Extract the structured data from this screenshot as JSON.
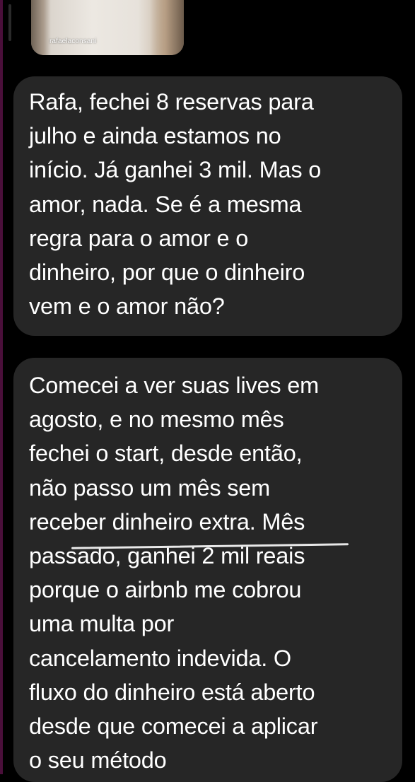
{
  "story_reply": {
    "username": "rafaelaconsani"
  },
  "messages": [
    {
      "lines": [
        "Rafa, fechei 8 reservas para",
        "julho e ainda estamos no",
        "início. Já ganhei 3 mil. Mas o",
        "amor, nada. Se é a mesma",
        "regra para o amor e o",
        "dinheiro, por que o dinheiro",
        "vem e o amor não?"
      ]
    },
    {
      "lines": [
        "Comecei a ver suas lives em",
        "agosto, e no mesmo mês",
        "fechei o start, desde então,",
        "não passo um mês sem",
        "receber dinheiro extra. Mês",
        "passado, ganhei 2 mil reais",
        "porque o airbnb me cobrou",
        "uma multa por",
        "cancelamento indevida. O",
        "fluxo do dinheiro está aberto",
        "desde que comecei a aplicar",
        "o seu método"
      ]
    }
  ],
  "colors": {
    "background": "#000000",
    "bubble": "#262626",
    "text": "#ffffff",
    "edge_accent": "#4a0f3a"
  }
}
